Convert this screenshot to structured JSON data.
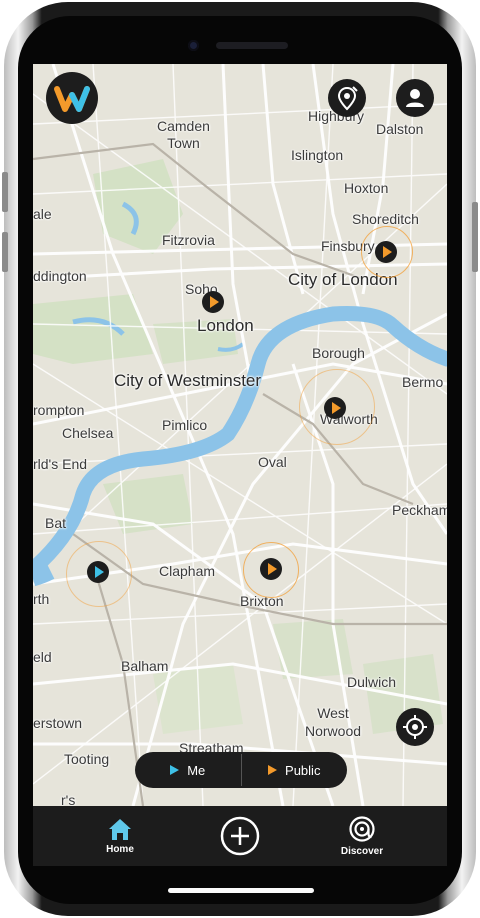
{
  "map": {
    "labels": {
      "camden_town": "Camden\nTown",
      "highbury": "Highbury",
      "dalston": "Dalston",
      "islington": "Islington",
      "hoxton": "Hoxton",
      "shoreditch": "Shoreditch",
      "finsbury": "Finsbury",
      "city_of_london": "City of London",
      "fitzrovia": "Fitzrovia",
      "paddington": "ddington",
      "vale": "ale",
      "soho": "Soho",
      "london": "London",
      "borough": "Borough",
      "bermondsey": "Bermo",
      "city_of_westminster": "City of Westminster",
      "brompton": "rompton",
      "chelsea": "Chelsea",
      "pimlico": "Pimlico",
      "walworth": "Walworth",
      "worlds_end": "rld's End",
      "oval": "Oval",
      "peckham": "Peckham",
      "battersea": "Bat",
      "clapham": "Clapham",
      "brixton": "Brixton",
      "north": "rth",
      "field": "eld",
      "balham": "Balham",
      "dulwich": "Dulwich",
      "west_norwood": "West\nNorwood",
      "tooting": "Tooting",
      "streatham": "Streatham",
      "summerstown": "erstown",
      "partial_s": "r's"
    }
  },
  "feed_toggle": {
    "me_label": "Me",
    "public_label": "Public"
  },
  "tabbar": {
    "home_label": "Home",
    "discover_label": "Discover"
  },
  "colors": {
    "accent_orange": "#f39a2b",
    "accent_blue": "#3ec0e6",
    "dark": "#1d1d1d",
    "water": "#8cc3e8"
  },
  "icons": {
    "logo": "w-logo-icon",
    "add_pin": "map-pin-add-icon",
    "profile": "user-icon",
    "locate": "crosshair-icon",
    "home": "home-icon",
    "create": "plus-circle-icon",
    "discover": "at-sign-icon"
  }
}
